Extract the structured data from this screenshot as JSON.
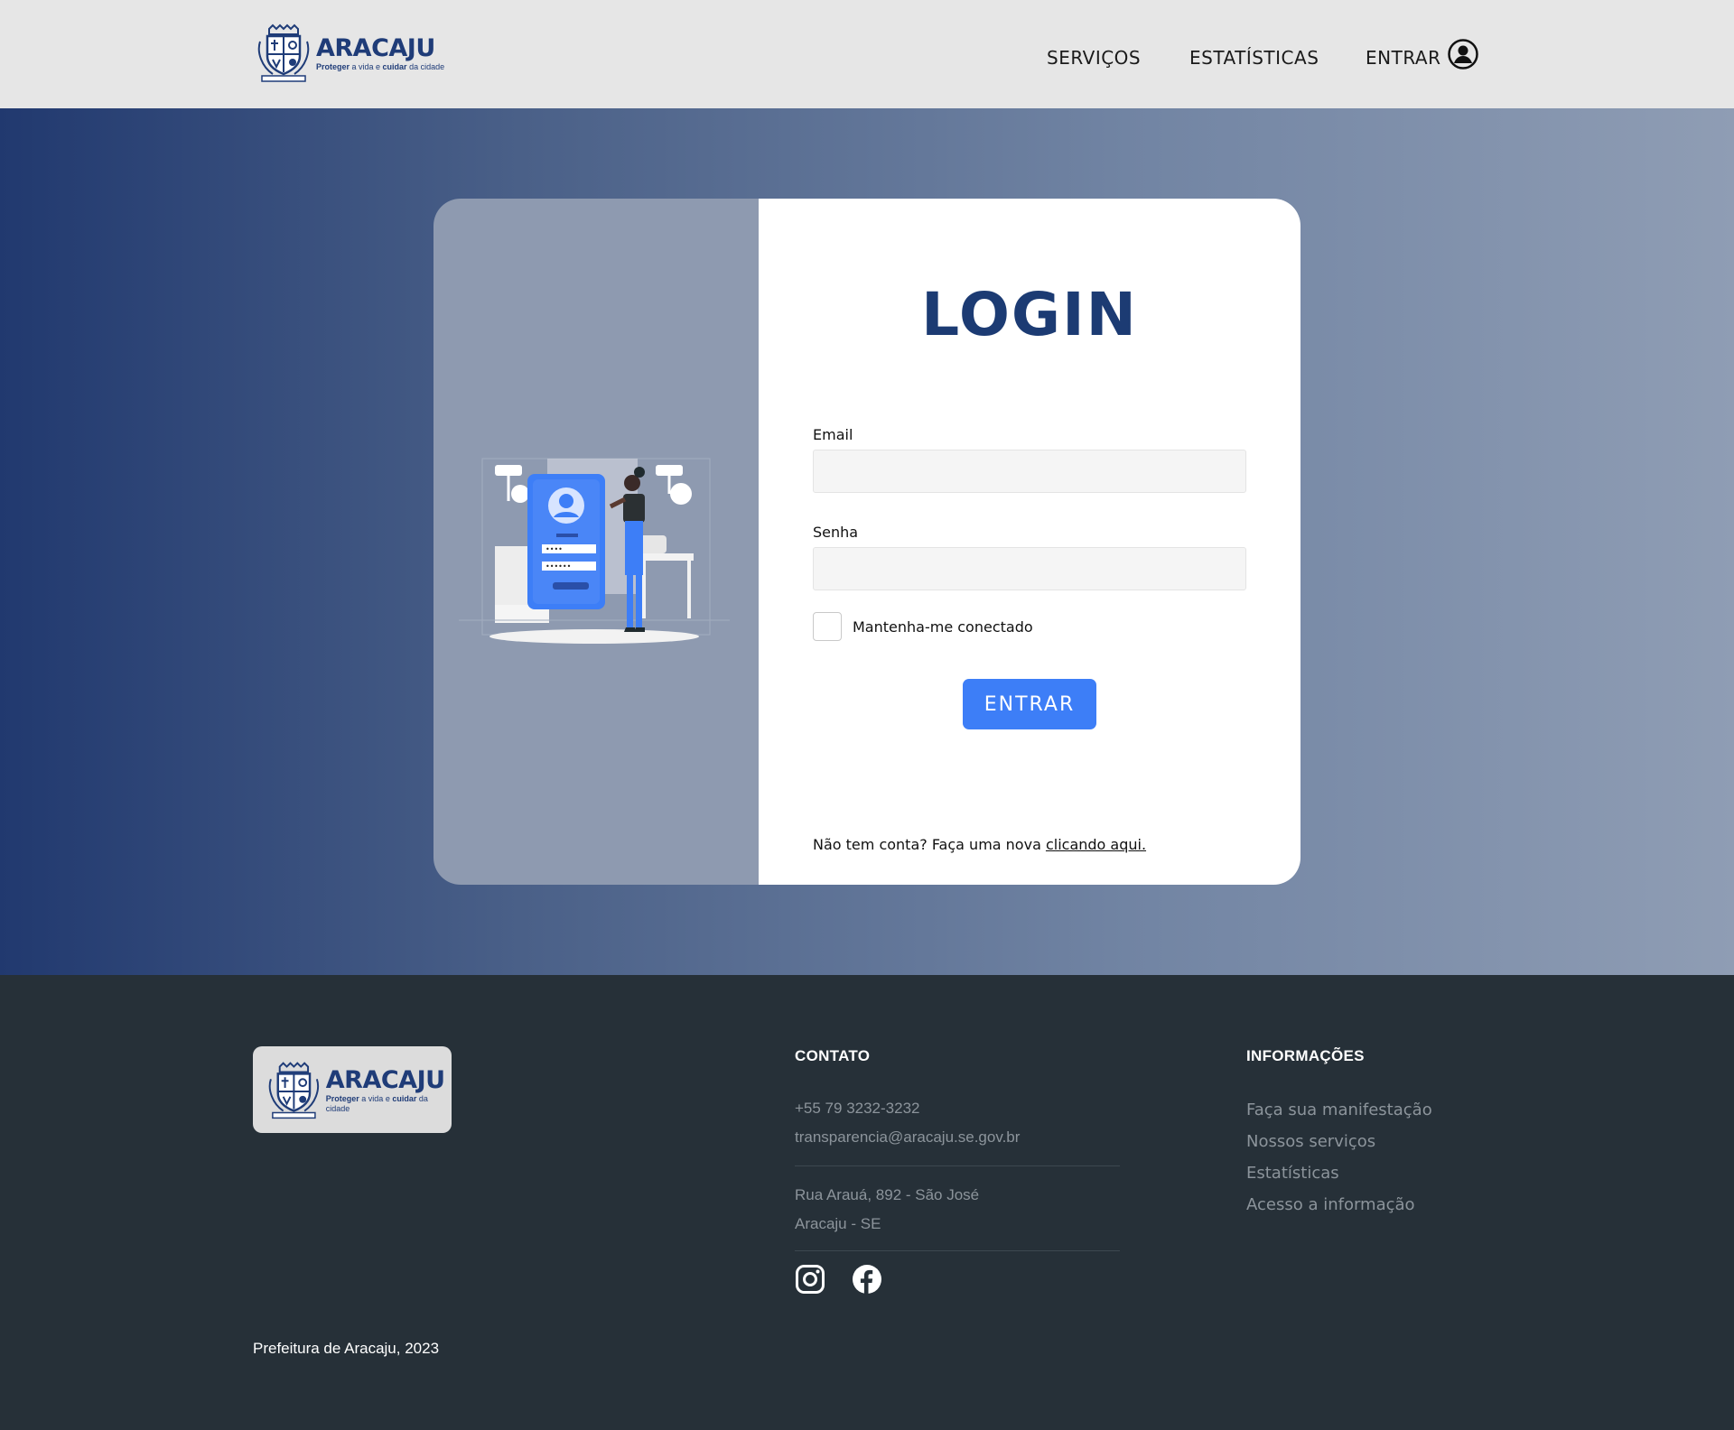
{
  "header": {
    "logo": {
      "name": "ARACAJU",
      "tag_bold_1": "Proteger",
      "tag_mid": " a vida e ",
      "tag_bold_2": "cuidar",
      "tag_end": " da cidade"
    },
    "nav": [
      {
        "label": "SERVIÇOS"
      },
      {
        "label": "ESTATÍSTICAS"
      },
      {
        "label": "ENTRAR"
      }
    ],
    "user_icon": "user-circle-icon"
  },
  "login": {
    "title": "LOGIN",
    "email_label": "Email",
    "email_value": "",
    "password_label": "Senha",
    "password_value": "",
    "remember_label": "Mantenha-me conectado",
    "remember_checked": false,
    "submit_label": "ENTRAR",
    "signup_text": "Não tem conta? Faça uma nova ",
    "signup_link": "clicando aqui."
  },
  "footer": {
    "logo": {
      "name": "ARACAJU",
      "tag_bold_1": "Proteger",
      "tag_mid": " a vida e ",
      "tag_bold_2": "cuidar",
      "tag_end": " da cidade"
    },
    "contact_title": "CONTATO",
    "phone": "+55 79 3232-3232",
    "email": "transparencia@aracaju.se.gov.br",
    "address_line1": "Rua Arauá, 892 - São José",
    "address_line2": "Aracaju - SE",
    "social": [
      "instagram-icon",
      "facebook-icon"
    ],
    "info_title": "INFORMAÇÕES",
    "info_links": [
      "Faça sua manifestação",
      "Nossos serviços",
      "Estatísticas",
      "Acesso a informação"
    ],
    "copyright": "Prefeitura de Aracaju, 2023"
  },
  "colors": {
    "brand_navy": "#1c3b73",
    "button_blue": "#3d7ef7",
    "footer_bg": "#263038",
    "header_bg": "#e6e6e6"
  }
}
